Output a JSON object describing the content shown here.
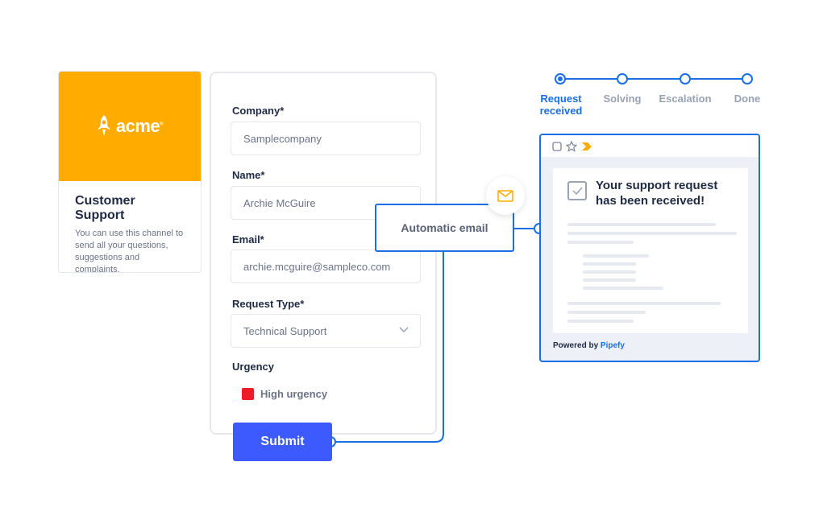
{
  "brand": {
    "logo_text": "acme",
    "logo_mark": "®",
    "title": "Customer Support",
    "description": "You can use this channel to send all your questions, suggestions and complaints."
  },
  "form": {
    "fields": [
      {
        "label": "Company*",
        "value": "Samplecompany"
      },
      {
        "label": "Name*",
        "value": "Archie McGuire"
      },
      {
        "label": "Email*",
        "value": "archie.mcguire@sampleco.com"
      },
      {
        "label": "Request Type*",
        "value": "Technical Support"
      }
    ],
    "urgency_label": "Urgency",
    "urgency_value": "High urgency",
    "urgency_color": "#ee1c25",
    "submit_label": "Submit"
  },
  "automation": {
    "label": "Automatic email",
    "icon": "envelope-icon"
  },
  "progress": {
    "steps": [
      "Request received",
      "Solving",
      "Escalation",
      "Done"
    ],
    "active_index": 0
  },
  "preview": {
    "title": "Your support request has been received!",
    "powered_prefix": "Powered by",
    "powered_brand": "Pipefy"
  },
  "colors": {
    "brand": "#ffab00",
    "accent": "#1a6ee8",
    "submit": "#3d5afe"
  }
}
